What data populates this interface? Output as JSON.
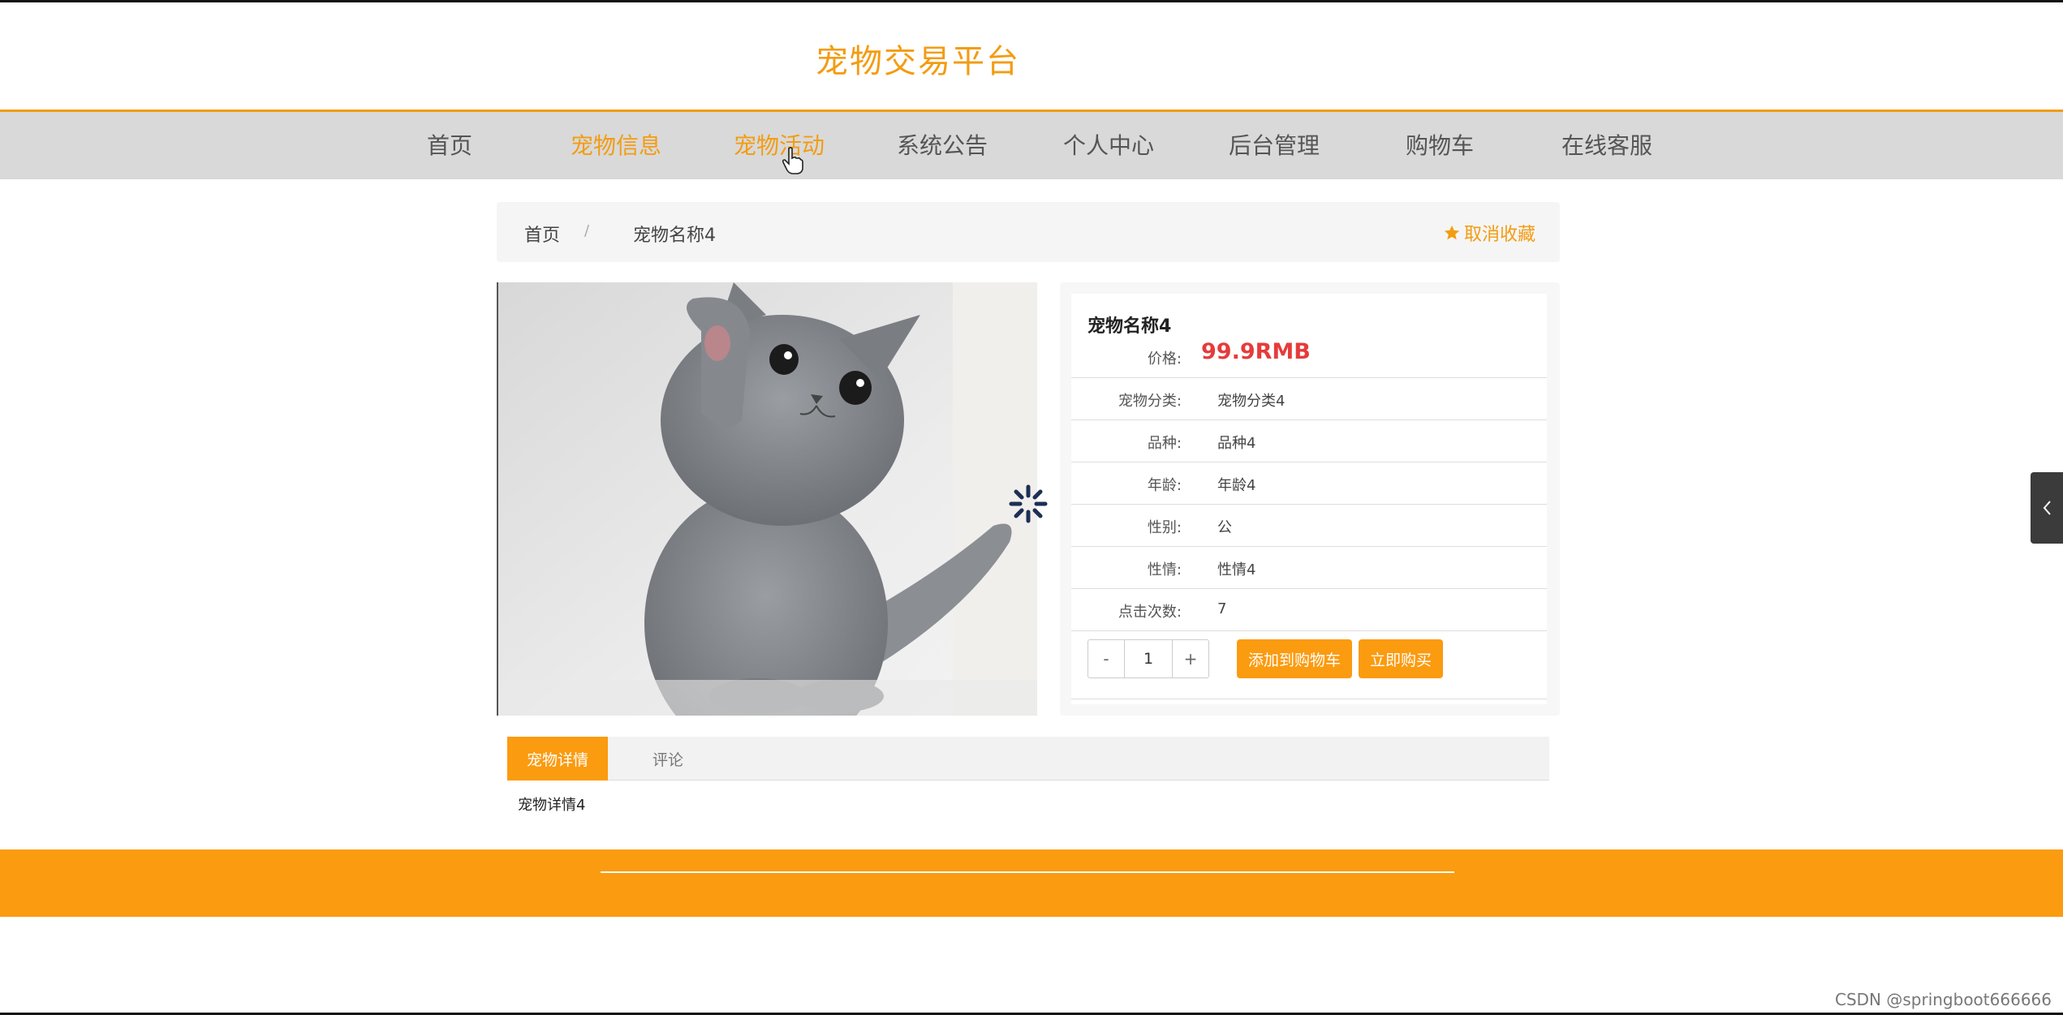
{
  "header": {
    "site_title": "宠物交易平台"
  },
  "nav": {
    "items": [
      {
        "label": "首页"
      },
      {
        "label": "宠物信息"
      },
      {
        "label": "宠物活动"
      },
      {
        "label": "系统公告"
      },
      {
        "label": "个人中心"
      },
      {
        "label": "后台管理"
      },
      {
        "label": "购物车"
      },
      {
        "label": "在线客服"
      }
    ]
  },
  "breadcrumb": {
    "home": "首页",
    "sep": "/",
    "current": "宠物名称4"
  },
  "favorite_button": {
    "label": "取消收藏"
  },
  "product": {
    "name": "宠物名称4",
    "price_label": "价格:",
    "price_value": "99.9RMB",
    "fields": [
      {
        "label": "宠物分类:",
        "value": "宠物分类4"
      },
      {
        "label": "品种:",
        "value": "品种4"
      },
      {
        "label": "年龄:",
        "value": "年龄4"
      },
      {
        "label": "性别:",
        "value": "公"
      },
      {
        "label": "性情:",
        "value": "性情4"
      },
      {
        "label": "点击次数:",
        "value": "7"
      }
    ],
    "quantity": {
      "minus": "-",
      "value": "1",
      "plus": "+"
    },
    "add_to_cart": "添加到购物车",
    "buy_now": "立即购买"
  },
  "tabs": [
    {
      "label": "宠物详情"
    },
    {
      "label": "评论"
    }
  ],
  "tab_content": "宠物详情4",
  "watermark": "CSDN @springboot666666",
  "colors": {
    "accent": "#f39c12",
    "price": "#e63b3b",
    "nav_bg": "#d9d9d9",
    "footer": "#fb9b0f"
  }
}
